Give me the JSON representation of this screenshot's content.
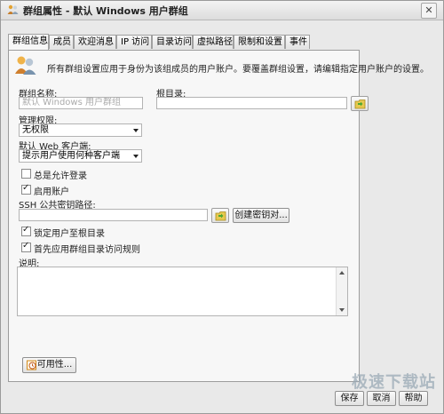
{
  "window": {
    "title": "群组属性 - 默认 Windows 用户群组"
  },
  "tabs": [
    {
      "label": "群组信息",
      "active": true
    },
    {
      "label": "成员"
    },
    {
      "label": "欢迎消息"
    },
    {
      "label": "IP 访问"
    },
    {
      "label": "目录访问"
    },
    {
      "label": "虚拟路径"
    },
    {
      "label": "限制和设置"
    },
    {
      "label": "事件"
    }
  ],
  "info": {
    "intro": "所有群组设置应用于身份为该组成员的用户账户。要覆盖群组设置，请编辑指定用户账户的设置。",
    "group_name_label": "群组名称:",
    "group_name_value": "默认 Windows 用户群组",
    "root_dir_label": "根目录:",
    "root_dir_value": "",
    "admin_label": "管理权限:",
    "admin_value": "无权限",
    "web_client_label": "默认 Web 客户端:",
    "web_client_value": "提示用户使用何种客户端",
    "always_allow_login": "总是允许登录",
    "enable_account": "启用账户",
    "ssh_label": "SSH 公共密钥路径:",
    "ssh_value": "",
    "create_key_button": "创建密钥对...",
    "lock_root": "锁定用户至根目录",
    "apply_rules_first": "首先应用群组目录访问规则",
    "desc_label": "说明:",
    "availability_button": "可用性..."
  },
  "checkbox_states": {
    "always_allow_login": false,
    "enable_account": true,
    "lock_root": true,
    "apply_rules_first": true
  },
  "buttons": {
    "save": "保存",
    "cancel": "取消",
    "help": "帮助"
  },
  "watermark": "极速下载站",
  "colors": {
    "folder_icon": "#e7c94e",
    "arrow_icon": "#4ca733"
  }
}
